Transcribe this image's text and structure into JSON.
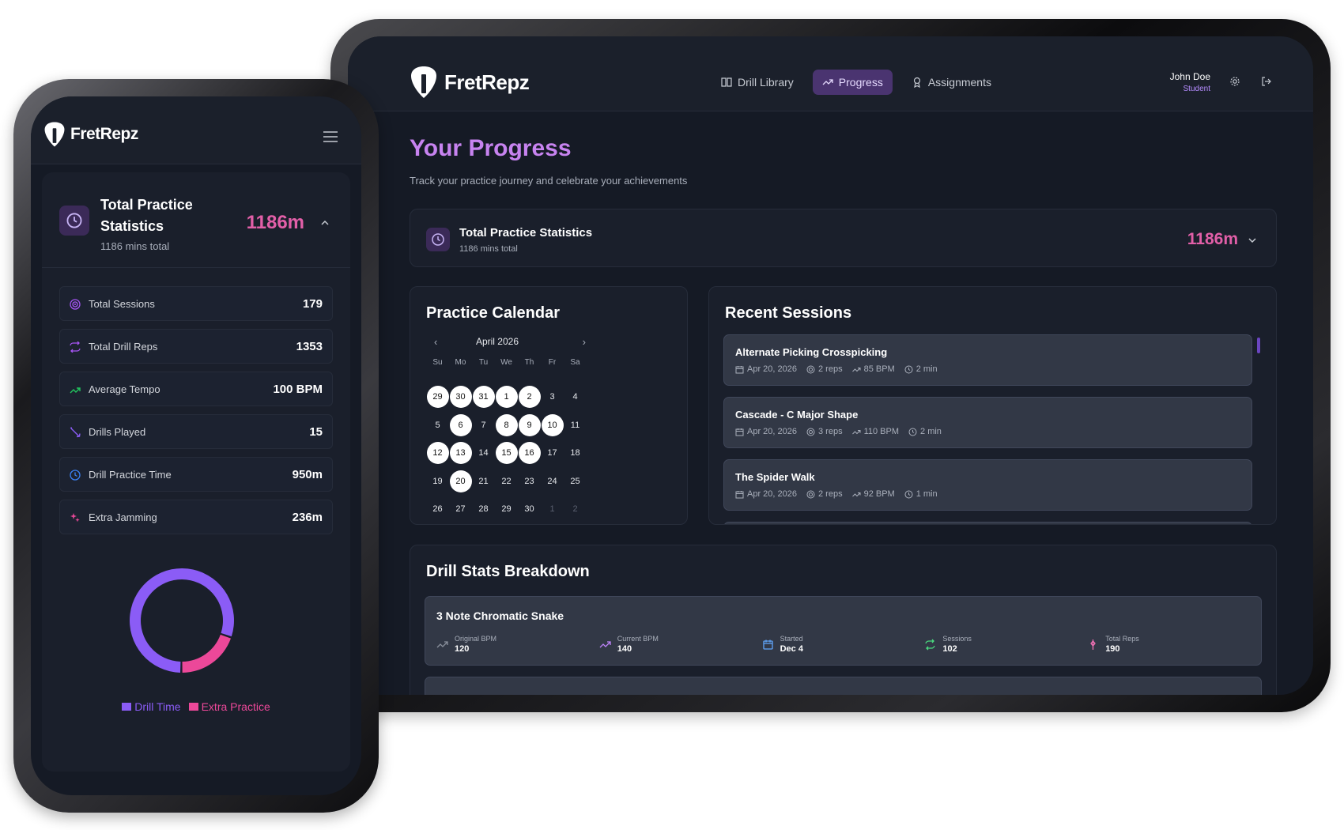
{
  "brand": {
    "name": "FretRepz"
  },
  "tablet": {
    "nav": [
      {
        "label": "Drill Library"
      },
      {
        "label": "Progress"
      },
      {
        "label": "Assignments"
      }
    ],
    "user": {
      "name": "John Doe",
      "role": "Student"
    },
    "page_title": "Your Progress",
    "page_subtitle": "Track your practice journey and celebrate your achievements",
    "stats_card": {
      "title": "Total Practice Statistics",
      "subtitle": "1186 mins total",
      "value": "1186m"
    },
    "calendar": {
      "title": "Practice Calendar",
      "month": "April 2026",
      "weekdays": [
        "Su",
        "Mo",
        "Tu",
        "We",
        "Th",
        "Fr",
        "Sa"
      ],
      "days": [
        {
          "d": "29",
          "hl": true
        },
        {
          "d": "30",
          "hl": true
        },
        {
          "d": "31",
          "hl": true
        },
        {
          "d": "1",
          "hl": true
        },
        {
          "d": "2",
          "hl": true
        },
        {
          "d": "3"
        },
        {
          "d": "4"
        },
        {
          "d": "5"
        },
        {
          "d": "6",
          "hl": true
        },
        {
          "d": "7"
        },
        {
          "d": "8",
          "hl": true
        },
        {
          "d": "9",
          "hl": true
        },
        {
          "d": "10",
          "hl": true
        },
        {
          "d": "11"
        },
        {
          "d": "12",
          "hl": true
        },
        {
          "d": "13",
          "hl": true
        },
        {
          "d": "14"
        },
        {
          "d": "15",
          "hl": true
        },
        {
          "d": "16",
          "hl": true
        },
        {
          "d": "17"
        },
        {
          "d": "18"
        },
        {
          "d": "19"
        },
        {
          "d": "20",
          "hl": true
        },
        {
          "d": "21"
        },
        {
          "d": "22"
        },
        {
          "d": "23"
        },
        {
          "d": "24"
        },
        {
          "d": "25"
        },
        {
          "d": "26"
        },
        {
          "d": "27"
        },
        {
          "d": "28"
        },
        {
          "d": "29"
        },
        {
          "d": "30"
        },
        {
          "d": "1",
          "muted": true
        },
        {
          "d": "2",
          "muted": true
        }
      ]
    },
    "recent_sessions": {
      "title": "Recent Sessions",
      "items": [
        {
          "name": "Alternate Picking Crosspicking",
          "date": "Apr 20, 2026",
          "reps": "2 reps",
          "bpm": "85 BPM",
          "time": "2 min"
        },
        {
          "name": "Cascade - C Major Shape",
          "date": "Apr 20, 2026",
          "reps": "3 reps",
          "bpm": "110 BPM",
          "time": "2 min"
        },
        {
          "name": "The Spider Walk",
          "date": "Apr 20, 2026",
          "reps": "2 reps",
          "bpm": "92 BPM",
          "time": "1 min"
        }
      ]
    },
    "drill_stats": {
      "title": "Drill Stats Breakdown",
      "items": [
        {
          "name": "3 Note Chromatic Snake",
          "stats": [
            {
              "label": "Original BPM",
              "value": "120"
            },
            {
              "label": "Current BPM",
              "value": "140"
            },
            {
              "label": "Started",
              "value": "Dec 4"
            },
            {
              "label": "Sessions",
              "value": "102"
            },
            {
              "label": "Total Reps",
              "value": "190"
            }
          ]
        }
      ]
    }
  },
  "phone": {
    "stats_card": {
      "title": "Total Practice Statistics",
      "subtitle": "1186 mins total",
      "value": "1186m"
    },
    "stats": [
      {
        "label": "Total Sessions",
        "value": "179",
        "icon": "target-icon",
        "color": "#a855f7"
      },
      {
        "label": "Total Drill Reps",
        "value": "1353",
        "icon": "repeat-icon",
        "color": "#a855f7"
      },
      {
        "label": "Average Tempo",
        "value": "100 BPM",
        "icon": "trending-up-icon",
        "color": "#22c55e"
      },
      {
        "label": "Drills Played",
        "value": "15",
        "icon": "guitar-icon",
        "color": "#8b5cf6"
      },
      {
        "label": "Drill Practice Time",
        "value": "950m",
        "icon": "clock-icon",
        "color": "#3b82f6"
      },
      {
        "label": "Extra Jamming",
        "value": "236m",
        "icon": "sparkle-icon",
        "color": "#ec4899"
      }
    ],
    "chart_data": {
      "type": "pie",
      "categories": [
        "Drill Time",
        "Extra Practice"
      ],
      "values": [
        950,
        236
      ],
      "colors": [
        "#8b5cf6",
        "#ec4899"
      ],
      "legend": "bottom"
    }
  },
  "colors": {
    "accent": "#8b5cf6",
    "pink": "#e25fa8",
    "bg": "#151a25"
  }
}
